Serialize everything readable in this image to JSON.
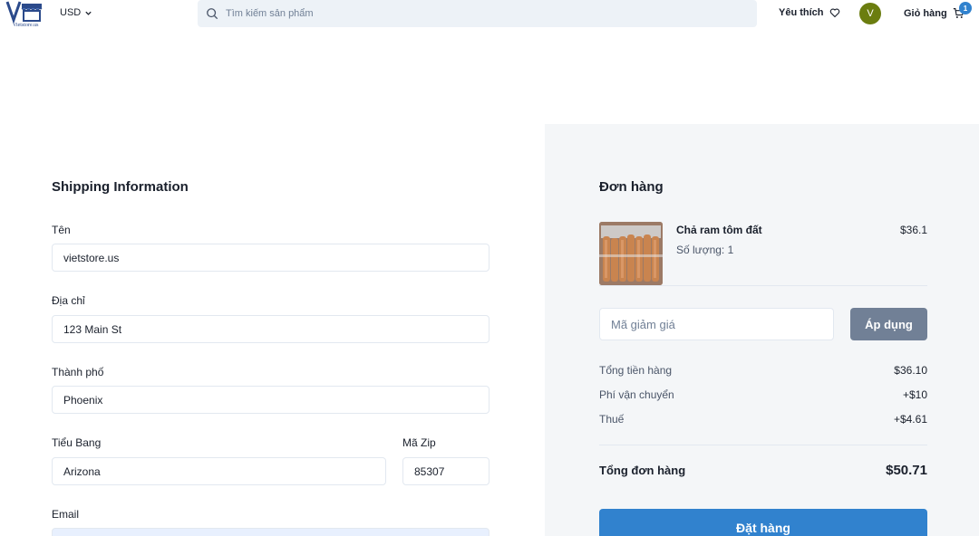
{
  "header": {
    "logo_text": "Vietstore.us",
    "currency": "USD",
    "search_placeholder": "Tìm kiếm sản phẩm",
    "wishlist_label": "Yêu thích",
    "avatar_initial": "V",
    "cart_label": "Giỏ hàng",
    "cart_count": "1"
  },
  "shipping": {
    "title": "Shipping Information",
    "name_label": "Tên",
    "name_value": "vietstore.us",
    "address_label": "Địa chỉ",
    "address_value": "123 Main St",
    "city_label": "Thành phố",
    "city_value": "Phoenix",
    "state_label": "Tiểu Bang",
    "state_value": "Arizona",
    "zip_label": "Mã Zip",
    "zip_value": "85307",
    "email_label": "Email"
  },
  "order": {
    "title": "Đơn hàng",
    "product": {
      "name": "Chả ram tôm đất",
      "quantity": "Số lượng: 1",
      "price": "$36.1"
    },
    "coupon_placeholder": "Mã giảm giá",
    "apply_label": "Áp dụng",
    "subtotal_label": "Tổng tiền hàng",
    "subtotal_value": "$36.10",
    "shipping_label": "Phí vận chuyển",
    "shipping_value": "+$10",
    "tax_label": "Thuế",
    "tax_value": "+$4.61",
    "total_label": "Tổng đơn hàng",
    "total_value": "$50.71",
    "place_order_label": "Đặt hàng"
  },
  "colors": {
    "primary": "#3182ce",
    "avatar": "#6b7d0f",
    "apply_button": "#718096",
    "panel_bg": "#f4f6f8"
  }
}
